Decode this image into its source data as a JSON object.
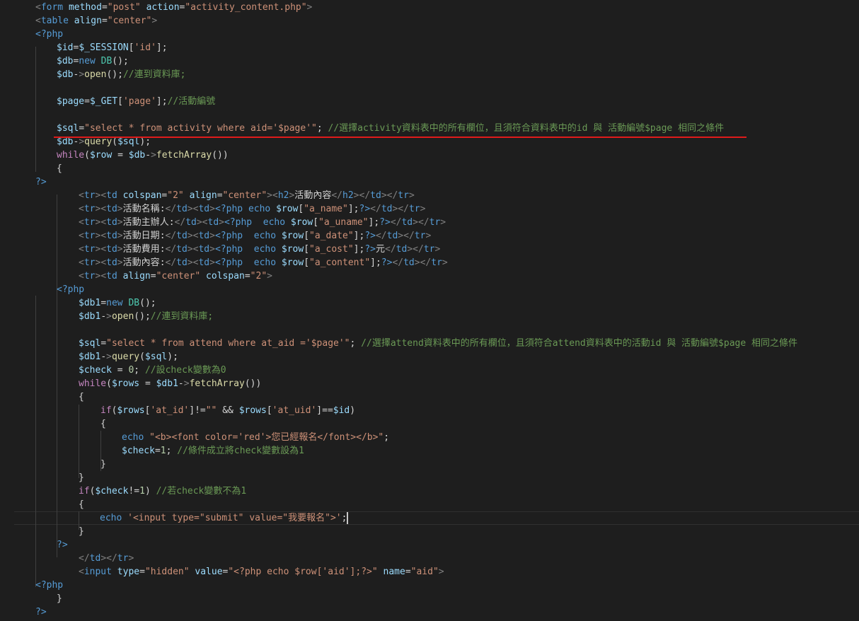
{
  "editor": {
    "language": "php",
    "theme_background": "#1e1e1e",
    "highlight_color": "#e01b1b",
    "lines": [
      "<form method=\"post\" action=\"activity_content.php\">",
      "<table align=\"center\">",
      "<?php",
      "$id=$_SESSION['id'];",
      "$db=new DB();",
      "$db->open();//連到資料庫;",
      "",
      "$page=$_GET['page'];//活動編號",
      "",
      "$sql=\"select * from activity where aid='$page'\"; //選擇activity資料表中的所有欄位，且須符合資料表中的id 與 活動編號$page 相同之條件",
      "$db->query($sql);",
      "while($row = $db->fetchArray())",
      "{",
      "?>",
      "<tr><td colspan=\"2\" align=\"center\"><h2>活動內容</h2></td></tr>",
      "<tr><td>活動名稱:</td><td><?php echo $row[\"a_name\"];?></td></tr>",
      "<tr><td>活動主辦人:</td><td><?php  echo $row[\"a_uname\"];?></td></tr>",
      "<tr><td>活動日期:</td><td><?php  echo $row[\"a_date\"];?></td></tr>",
      "<tr><td>活動費用:</td><td><?php  echo $row[\"a_cost\"];?>元</td></tr>",
      "<tr><td>活動內容:</td><td><?php  echo $row[\"a_content\"];?></td></tr>",
      "<tr><td align=\"center\" colspan=\"2\">",
      "<?php",
      "$db1=new DB();",
      "$db1->open();//連到資料庫;",
      "",
      "$sql=\"select * from attend where at_aid ='$page'\"; //選擇attend資料表中的所有欄位，且須符合attend資料表中的活動id 與 活動編號$page 相同之條件",
      "$db1->query($sql);",
      "$check = 0; //設check變數為0",
      "while($rows = $db1->fetchArray())",
      "{",
      "if($rows['at_id']!=\"\" && $rows['at_uid']==$id)",
      "{",
      "echo \"<b><font color='red'>您已經報名</font></b>\";",
      "$check=1; //條件成立將check變數設為1",
      "}",
      "}",
      "if($check!=1) //若check變數不為1",
      "{",
      "echo '<input type=\"submit\" value=\"我要報名\">';",
      "}",
      "?>",
      "</td></tr>",
      "<input type=\"hidden\" value=\"<?php echo $row['aid'];?>\" name=\"aid\">",
      "<?php",
      "}",
      "?>"
    ]
  }
}
